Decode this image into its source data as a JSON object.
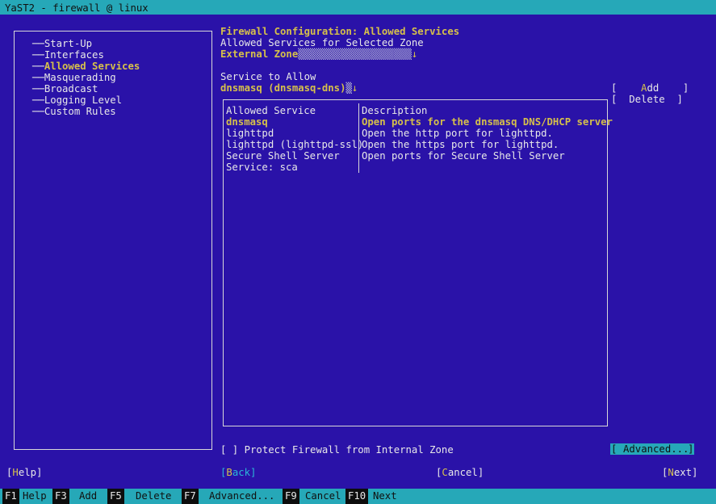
{
  "window": {
    "title": "YaST2 - firewall @ linux"
  },
  "sidebar": {
    "items": [
      {
        "label": "Start-Up"
      },
      {
        "label": "Interfaces"
      },
      {
        "label": "Allowed Services"
      },
      {
        "label": "Masquerading"
      },
      {
        "label": "Broadcast"
      },
      {
        "label": "Logging Level"
      },
      {
        "label": "Custom Rules"
      }
    ],
    "selected": "Allowed Services"
  },
  "main": {
    "heading": "Firewall Configuration: Allowed Services",
    "zone_label": "Allowed Services for Selected Zone",
    "zone_value": "External Zone",
    "service_label": "Service to Allow",
    "service_value": "dnsmasq (dnsmasq-dns)",
    "add_button": "Add",
    "delete_button": "Delete",
    "table": {
      "headers": [
        "Allowed Service",
        "Description"
      ],
      "rows": [
        {
          "service": "dnsmasq",
          "description": "Open ports for the dnsmasq DNS/DHCP server"
        },
        {
          "service": "lighttpd",
          "description": "Open the http port for lighttpd."
        },
        {
          "service": "lighttpd (lighttpd-ssl)",
          "description": "Open the https port for lighttpd."
        },
        {
          "service": "Secure Shell Server",
          "description": "Open ports for Secure Shell Server"
        },
        {
          "service": "Service: sca",
          "description": ""
        }
      ]
    },
    "protect_checkbox": {
      "label": "Protect Firewall from Internal Zone",
      "checked": false
    },
    "advanced_button": "Advanced..."
  },
  "buttons": {
    "help": "Help",
    "back": "Back",
    "cancel": "Cancel",
    "next": "Next"
  },
  "footer": {
    "keys": [
      {
        "key": "F1",
        "label": "Help"
      },
      {
        "key": "F3",
        "label": "Add"
      },
      {
        "key": "F5",
        "label": "Delete"
      },
      {
        "key": "F7",
        "label": "Advanced..."
      },
      {
        "key": "F9",
        "label": "Cancel"
      },
      {
        "key": "F10",
        "label": "Next"
      }
    ]
  },
  "colors": {
    "background": "#2a12a8",
    "accent": "#26a8b8",
    "highlight": "#d6c04a"
  }
}
